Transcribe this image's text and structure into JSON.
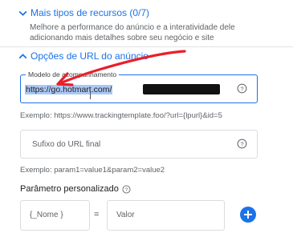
{
  "more_resources": {
    "title": "Mais tipos de recursos (0/7)",
    "description": "Melhore a performance do anúncio e a interatividade dele adicionando mais detalhes sobre seu negócio e site"
  },
  "url_options": {
    "title": "Opções de URL do anúncio"
  },
  "tracking_template": {
    "label": "Modelo de acompanhamento",
    "value": "https://go.hotmart.com/",
    "example": "Exemplo: https://www.trackingtemplate.foo/?url={lpurl}&id=5"
  },
  "final_url_suffix": {
    "placeholder": "Sufixo do URL final",
    "example": "Exemplo: param1=value1&param2=value2"
  },
  "custom_param": {
    "title": "Parâmetro personalizado",
    "name_placeholder": "{_Nome        }",
    "equals": "=",
    "value_placeholder": "Valor"
  },
  "colors": {
    "accent": "#1a73e8",
    "annotation": "#e8202a"
  }
}
